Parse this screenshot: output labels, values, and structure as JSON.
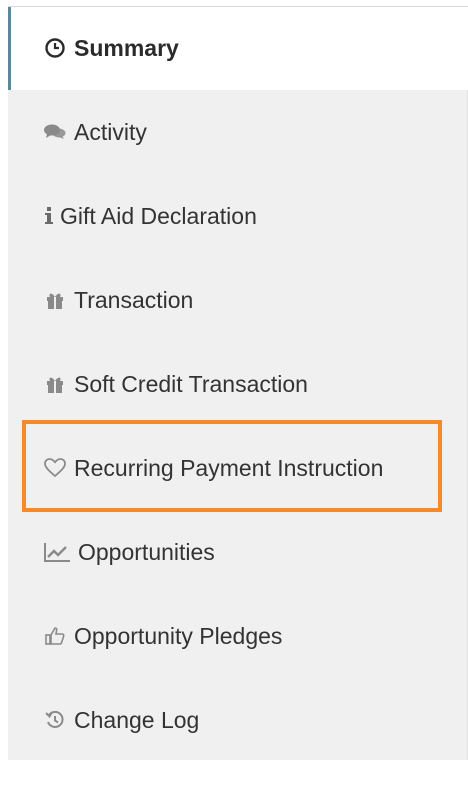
{
  "nav": {
    "items": [
      {
        "label": "Summary",
        "icon": "clock-icon",
        "active": true
      },
      {
        "label": "Activity",
        "icon": "comments-icon"
      },
      {
        "label": "Gift Aid Declaration",
        "icon": "info-icon"
      },
      {
        "label": "Transaction",
        "icon": "gift-icon"
      },
      {
        "label": "Soft Credit Transaction",
        "icon": "gift-icon"
      },
      {
        "label": "Recurring Payment Instruction",
        "icon": "heart-icon",
        "highlighted": true
      },
      {
        "label": "Opportunities",
        "icon": "line-chart-icon"
      },
      {
        "label": "Opportunity Pledges",
        "icon": "thumbs-up-icon"
      },
      {
        "label": "Change Log",
        "icon": "history-icon"
      }
    ]
  },
  "colors": {
    "highlight": "#f58a2a",
    "active_border": "#5a8a9a",
    "menu_background": "#f0f0f0"
  }
}
